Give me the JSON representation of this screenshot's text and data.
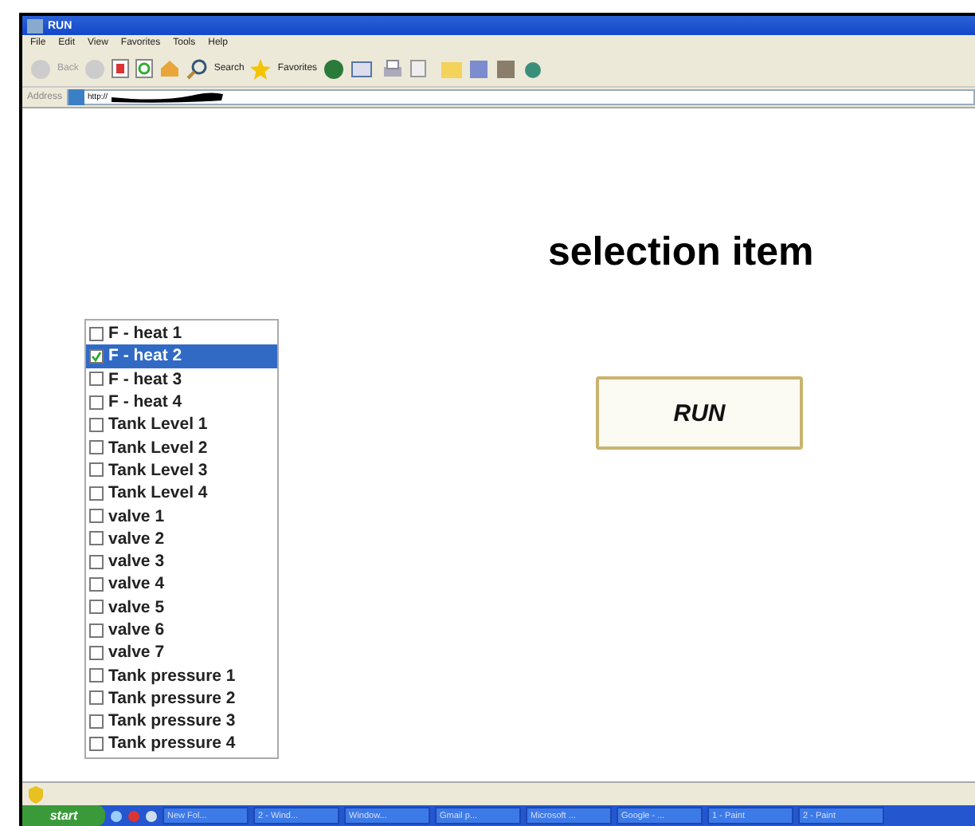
{
  "window": {
    "title": "RUN"
  },
  "menu": [
    "File",
    "Edit",
    "View",
    "Favorites",
    "Tools",
    "Help"
  ],
  "toolbar": {
    "back": "Back",
    "search": "Search",
    "favorites": "Favorites"
  },
  "address": {
    "label": "Address",
    "value": "http://"
  },
  "page": {
    "heading": "selection item",
    "run_button": "RUN",
    "items": [
      {
        "label": "F - heat 1",
        "checked": false,
        "selected": false
      },
      {
        "label": "F - heat 2",
        "checked": true,
        "selected": true
      },
      {
        "label": "F - heat 3",
        "checked": false,
        "selected": false
      },
      {
        "label": "F - heat 4",
        "checked": false,
        "selected": false
      },
      {
        "label": "Tank Level 1",
        "checked": false,
        "selected": false
      },
      {
        "label": "Tank Level 2",
        "checked": false,
        "selected": false
      },
      {
        "label": "Tank Level 3",
        "checked": false,
        "selected": false
      },
      {
        "label": "Tank Level 4",
        "checked": false,
        "selected": false
      },
      {
        "label": "valve 1",
        "checked": false,
        "selected": false
      },
      {
        "label": "valve 2",
        "checked": false,
        "selected": false
      },
      {
        "label": "valve 3",
        "checked": false,
        "selected": false
      },
      {
        "label": "valve 4",
        "checked": false,
        "selected": false
      },
      {
        "label": "valve 5",
        "checked": false,
        "selected": false
      },
      {
        "label": "valve 6",
        "checked": false,
        "selected": false
      },
      {
        "label": "valve 7",
        "checked": false,
        "selected": false
      },
      {
        "label": "Tank pressure 1",
        "checked": false,
        "selected": false
      },
      {
        "label": "Tank pressure 2",
        "checked": false,
        "selected": false
      },
      {
        "label": "Tank pressure 3",
        "checked": false,
        "selected": false
      },
      {
        "label": "Tank pressure 4",
        "checked": false,
        "selected": false
      }
    ]
  },
  "taskbar": {
    "start": "start",
    "tasks": [
      "New Fol...",
      "2 - Wind...",
      "Window...",
      "Gmail p...",
      "Microsoft ...",
      "Google - ...",
      "1 - Paint",
      "2 - Paint"
    ]
  }
}
